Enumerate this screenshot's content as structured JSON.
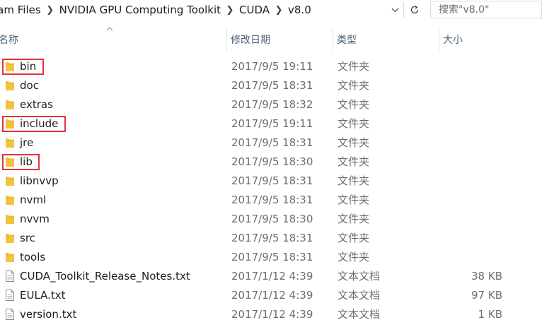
{
  "breadcrumb": {
    "items": [
      "ram Files",
      "NVIDIA GPU Computing Toolkit",
      "CUDA",
      "v8.0"
    ],
    "separator_icon": "chevron-right-icon"
  },
  "address_bar": {
    "dropdown_icon": "chevron-down-icon",
    "refresh_icon": "refresh-icon"
  },
  "search": {
    "placeholder": "搜索\"v8.0\"",
    "value": ""
  },
  "columns": {
    "name": "名称",
    "date": "修改日期",
    "type": "类型",
    "size": "大小",
    "sort_column": "name",
    "sort_icon": "sort-up-icon"
  },
  "colors": {
    "folder": "#f4c240",
    "highlight": "#e8303a",
    "header_text": "#4c607a"
  },
  "files": [
    {
      "name": "bin",
      "date": "2017/9/5 19:11",
      "type": "文件夹",
      "size": "",
      "kind": "folder",
      "highlighted": true
    },
    {
      "name": "doc",
      "date": "2017/9/5 18:31",
      "type": "文件夹",
      "size": "",
      "kind": "folder",
      "highlighted": false
    },
    {
      "name": "extras",
      "date": "2017/9/5 18:32",
      "type": "文件夹",
      "size": "",
      "kind": "folder",
      "highlighted": false
    },
    {
      "name": "include",
      "date": "2017/9/5 19:11",
      "type": "文件夹",
      "size": "",
      "kind": "folder",
      "highlighted": true
    },
    {
      "name": "jre",
      "date": "2017/9/5 18:31",
      "type": "文件夹",
      "size": "",
      "kind": "folder",
      "highlighted": false
    },
    {
      "name": "lib",
      "date": "2017/9/5 18:30",
      "type": "文件夹",
      "size": "",
      "kind": "folder",
      "highlighted": true
    },
    {
      "name": "libnvvp",
      "date": "2017/9/5 18:31",
      "type": "文件夹",
      "size": "",
      "kind": "folder",
      "highlighted": false
    },
    {
      "name": "nvml",
      "date": "2017/9/5 18:31",
      "type": "文件夹",
      "size": "",
      "kind": "folder",
      "highlighted": false
    },
    {
      "name": "nvvm",
      "date": "2017/9/5 18:30",
      "type": "文件夹",
      "size": "",
      "kind": "folder",
      "highlighted": false
    },
    {
      "name": "src",
      "date": "2017/9/5 18:31",
      "type": "文件夹",
      "size": "",
      "kind": "folder",
      "highlighted": false
    },
    {
      "name": "tools",
      "date": "2017/9/5 18:31",
      "type": "文件夹",
      "size": "",
      "kind": "folder",
      "highlighted": false
    },
    {
      "name": "CUDA_Toolkit_Release_Notes.txt",
      "date": "2017/1/12 4:39",
      "type": "文本文档",
      "size": "38 KB",
      "kind": "text",
      "highlighted": false
    },
    {
      "name": "EULA.txt",
      "date": "2017/1/12 4:39",
      "type": "文本文档",
      "size": "97 KB",
      "kind": "text",
      "highlighted": false
    },
    {
      "name": "version.txt",
      "date": "2017/1/12 4:39",
      "type": "文本文档",
      "size": "1 KB",
      "kind": "text",
      "highlighted": false
    }
  ]
}
